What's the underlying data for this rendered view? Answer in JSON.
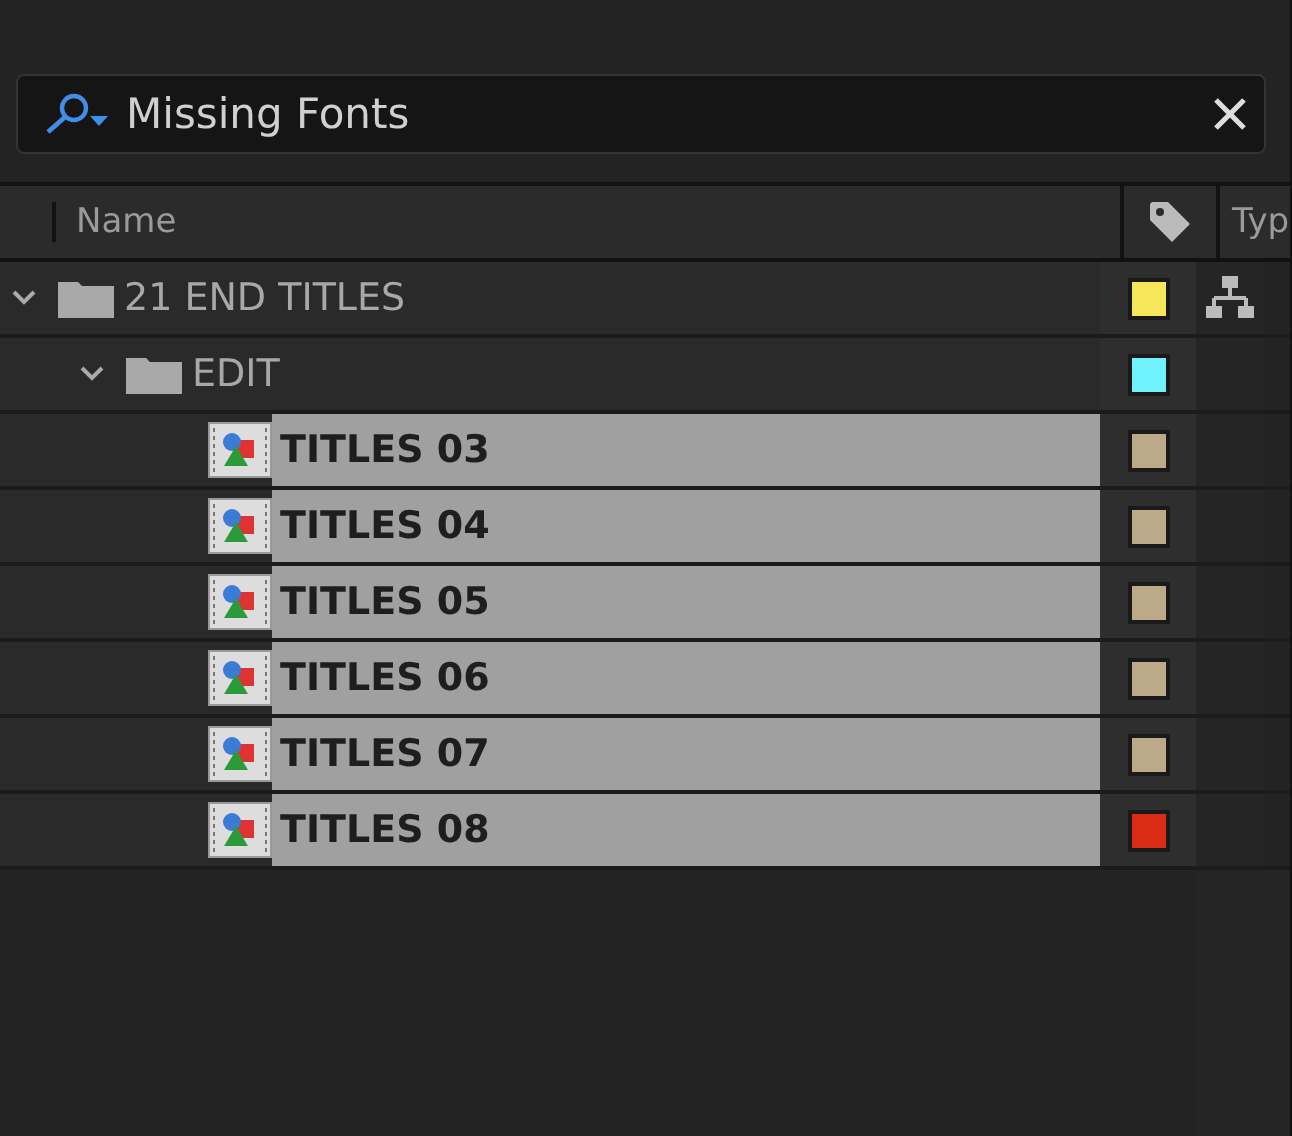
{
  "search": {
    "value": "Missing Fonts"
  },
  "columns": [
    {
      "label": "Name"
    },
    {
      "label": "Typ"
    }
  ],
  "items": [
    {
      "kind": "folder",
      "name": "21 END TITLES",
      "expanded": true,
      "selected": false,
      "color": "#f5e65a",
      "children": [
        {
          "kind": "folder",
          "name": "EDIT",
          "expanded": true,
          "selected": false,
          "color": "#6ff2fb",
          "children": [
            {
              "kind": "composition",
              "name": "TITLES 03",
              "selected": true,
              "color": "#bba988"
            },
            {
              "kind": "composition",
              "name": "TITLES 04",
              "selected": true,
              "color": "#bba988"
            },
            {
              "kind": "composition",
              "name": "TITLES 05",
              "selected": true,
              "color": "#bba988"
            },
            {
              "kind": "composition",
              "name": "TITLES 06",
              "selected": true,
              "color": "#bba988"
            },
            {
              "kind": "composition",
              "name": "TITLES 07",
              "selected": true,
              "color": "#bba988"
            },
            {
              "kind": "composition",
              "name": "TITLES 08",
              "selected": true,
              "color": "#db2a16"
            }
          ]
        }
      ]
    }
  ]
}
